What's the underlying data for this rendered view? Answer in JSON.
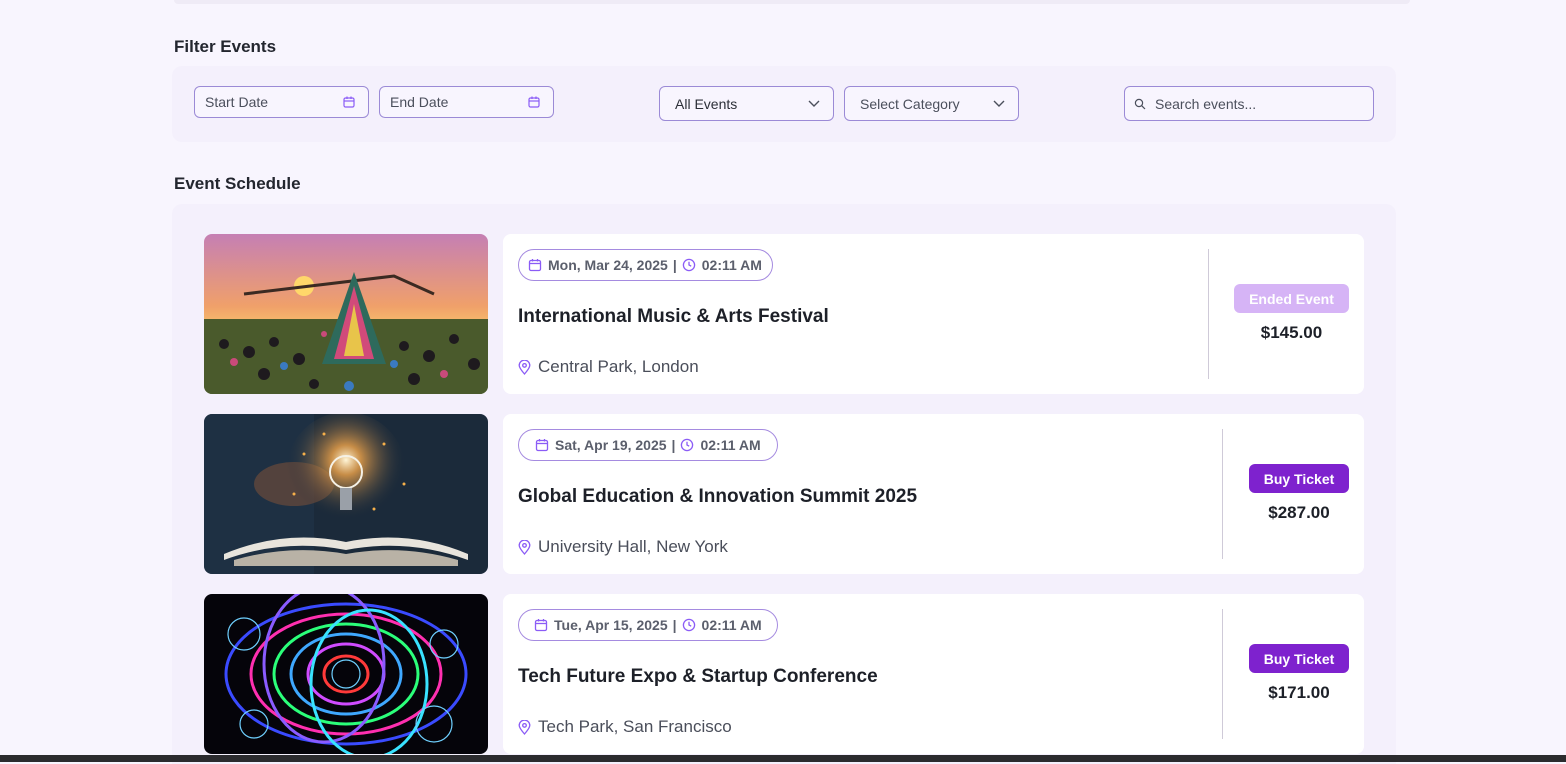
{
  "filters": {
    "heading": "Filter Events",
    "start_date_placeholder": "Start Date",
    "end_date_placeholder": "End Date",
    "event_scope_select": "All Events",
    "category_select": "Select Category",
    "search_placeholder": "Search events..."
  },
  "schedule": {
    "heading": "Event Schedule",
    "events": [
      {
        "date": "Mon, Mar 24, 2025",
        "time": "02:11 AM",
        "title": "International Music & Arts Festival",
        "location": "Central Park, London",
        "action": "Ended Event",
        "price": "$145.00"
      },
      {
        "date": "Sat, Apr 19, 2025",
        "time": "02:11 AM",
        "title": "Global Education & Innovation Summit 2025",
        "location": "University Hall, New York",
        "action": "Buy Ticket",
        "price": "$287.00"
      },
      {
        "date": "Tue, Apr 15, 2025",
        "time": "02:11 AM",
        "title": "Tech Future Expo & Startup Conference",
        "location": "Tech Park, San Francisco",
        "action": "Buy Ticket",
        "price": "$171.00"
      }
    ]
  },
  "icons": [
    "calendar-icon",
    "chevron-down-icon",
    "search-icon",
    "clock-icon",
    "location-pin-icon"
  ],
  "colors": {
    "accent": "#7e22ce",
    "ended": "#d6b4f6",
    "background": "#f8f5fe",
    "panel": "#f4f0fc"
  }
}
